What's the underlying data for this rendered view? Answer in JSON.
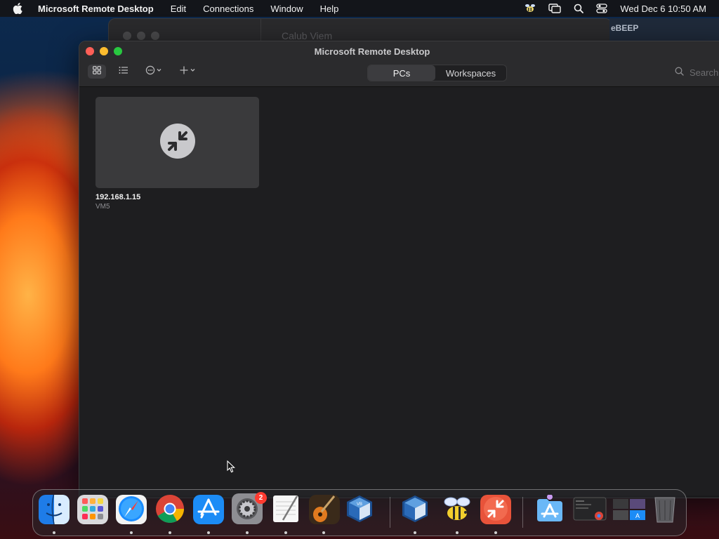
{
  "menubar": {
    "app_name": "Microsoft Remote Desktop",
    "menus": [
      "Edit",
      "Connections",
      "Window",
      "Help"
    ],
    "clock": "Wed Dec 6  10:50 AM"
  },
  "background_window": {
    "title": "Calub Viem"
  },
  "background_window_2": {
    "title": "eBEEP"
  },
  "window": {
    "title": "Microsoft Remote Desktop",
    "tabs": [
      {
        "label": "PCs",
        "active": true
      },
      {
        "label": "Workspaces",
        "active": false
      }
    ],
    "search_placeholder": "Search",
    "pcs": [
      {
        "name": "192.168.1.15",
        "user": "VM5"
      }
    ]
  },
  "dock": {
    "apps": [
      "Finder",
      "Launchpad",
      "Safari",
      "Google Chrome",
      "App Store",
      "System Settings",
      "TextEdit",
      "GarageBand",
      "VirtualBox",
      "VirtualBox VM",
      "BeeBEEP",
      "Microsoft Remote Desktop",
      "Downloads",
      "Window Preview",
      "Window Preview",
      "Trash"
    ],
    "system_settings_badge": "2"
  },
  "colors": {
    "accent_red": "#ff5f57",
    "accent_yellow": "#febc2e",
    "accent_green": "#28c840",
    "rdp_orange": "#e8533a",
    "badge_red": "#ff3b30"
  }
}
